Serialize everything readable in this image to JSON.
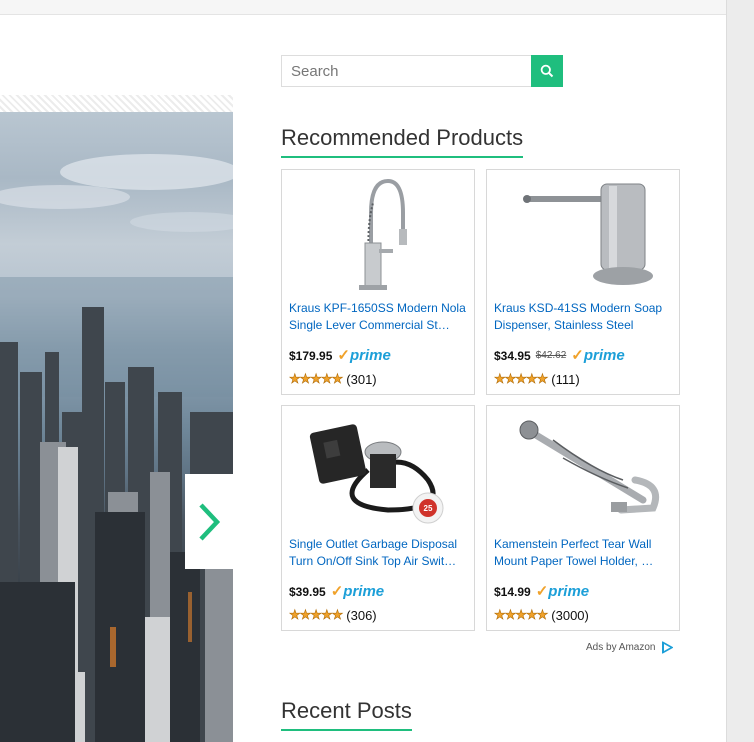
{
  "search": {
    "placeholder": "Search",
    "button_icon": "search-icon"
  },
  "recommended": {
    "title": "Recommended Products",
    "products": [
      {
        "title": "Kraus KPF-1650SS Modern Nola Single Lever Commercial St…",
        "price": "$179.95",
        "old_price": "",
        "prime": "prime",
        "rating": 4.5,
        "reviews": "(301)",
        "image": "faucet"
      },
      {
        "title": "Kraus KSD-41SS Modern Soap Dispenser, Stainless Steel",
        "price": "$34.95",
        "old_price": "$42.62",
        "prime": "prime",
        "rating": 4.5,
        "reviews": "(111)",
        "image": "soap-dispenser"
      },
      {
        "title": "Single Outlet Garbage Disposal Turn On/Off Sink Top Air Swit…",
        "price": "$39.95",
        "old_price": "",
        "prime": "prime",
        "rating": 4.5,
        "reviews": "(306)",
        "image": "air-switch"
      },
      {
        "title": "Kamenstein Perfect Tear Wall Mount Paper Towel Holder, …",
        "price": "$14.99",
        "old_price": "",
        "prime": "prime",
        "rating": 4.5,
        "reviews": "(3000)",
        "image": "towel-holder"
      }
    ],
    "ads_label": "Ads by Amazon"
  },
  "recent_posts": {
    "title": "Recent Posts"
  },
  "slider": {
    "next_icon": "chevron-right-icon",
    "image": "chicago-skyline"
  },
  "colors": {
    "accent": "#1fbe7e",
    "link": "#0066c0",
    "star": "#f0a22b",
    "prime": "#1c9fd8"
  }
}
